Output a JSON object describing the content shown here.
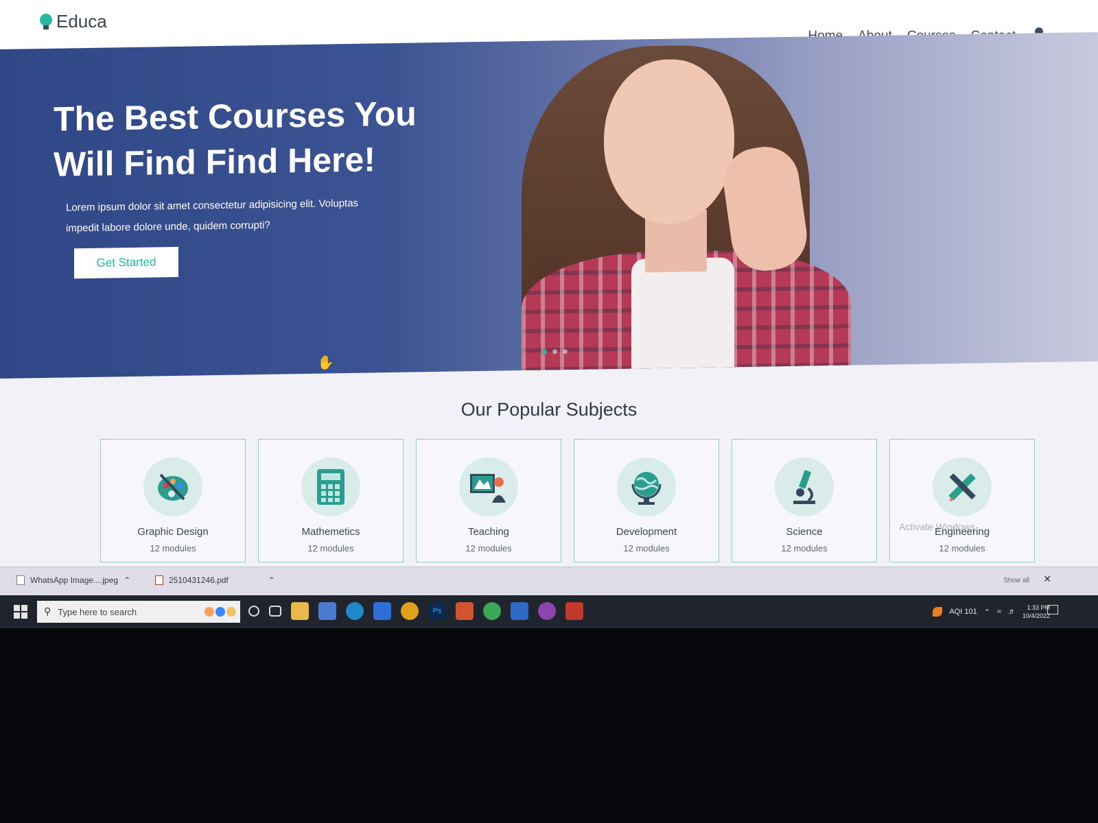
{
  "brand": {
    "name": "Educa",
    "accent": "#28b5a1"
  },
  "nav": {
    "items": [
      "Home",
      "About",
      "Courses",
      "Contact"
    ]
  },
  "hero": {
    "title": "The Best Courses You Will Find Find Here!",
    "text": "Lorem ipsum dolor sit amet consectetur adipisicing elit. Voluptas impedit labore dolore unde, quidem corrupti?",
    "button": "Get Started"
  },
  "subjects": {
    "title": "Our Popular Subjects",
    "items": [
      {
        "name": "Graphic Design",
        "modules": "12 modules",
        "icon": "palette-icon"
      },
      {
        "name": "Mathemetics",
        "modules": "12 modules",
        "icon": "calculator-icon"
      },
      {
        "name": "Teaching",
        "modules": "12 modules",
        "icon": "teacher-board-icon"
      },
      {
        "name": "Development",
        "modules": "12 modules",
        "icon": "globe-icon"
      },
      {
        "name": "Science",
        "modules": "12 modules",
        "icon": "microscope-icon"
      },
      {
        "name": "Engineering",
        "modules": "12 modules",
        "icon": "pencil-ruler-icon"
      }
    ]
  },
  "downloads": {
    "items": [
      "WhatsApp Image....jpeg",
      "2510431246.pdf"
    ],
    "show_all": "Show all"
  },
  "watermark": "Activate Windows",
  "taskbar": {
    "search_placeholder": "Type here to search",
    "aqi": "AQI 101",
    "time": "1:33 PM",
    "date": "10/4/2022"
  }
}
